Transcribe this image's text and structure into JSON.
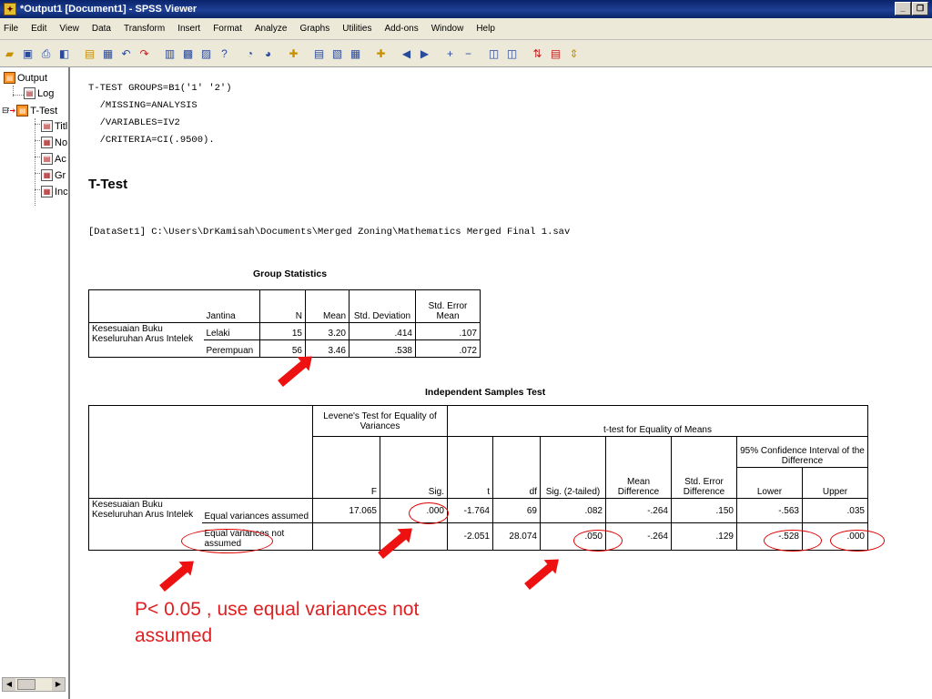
{
  "window": {
    "title": "*Output1 [Document1] - SPSS Viewer"
  },
  "menu": [
    "File",
    "Edit",
    "View",
    "Data",
    "Transform",
    "Insert",
    "Format",
    "Analyze",
    "Graphs",
    "Utilities",
    "Add-ons",
    "Window",
    "Help"
  ],
  "tree": {
    "output": "Output",
    "log": "Log",
    "ttest": "T-Test",
    "children": [
      "Titl",
      "No",
      "Ac",
      "Gr",
      "Inc"
    ]
  },
  "syntax": "T-TEST GROUPS=B1('1' '2')\n  /MISSING=ANALYSIS\n  /VARIABLES=IV2\n  /CRITERIA=CI(.9500).",
  "heading": "T-Test",
  "dataset": "[DataSet1] C:\\Users\\DrKamisah\\Documents\\Merged Zoning\\Mathematics Merged Final 1.sav",
  "group_stats": {
    "title": "Group Statistics",
    "headers": {
      "jantina": "Jantina",
      "n": "N",
      "mean": "Mean",
      "sd": "Std. Deviation",
      "se": "Std. Error Mean"
    },
    "variable": "Kesesuaian Buku Keseluruhan Arus Intelek",
    "rows": [
      {
        "group": "Lelaki",
        "n": "15",
        "mean": "3.20",
        "sd": ".414",
        "se": ".107"
      },
      {
        "group": "Perempuan",
        "n": "56",
        "mean": "3.46",
        "sd": ".538",
        "se": ".072"
      }
    ]
  },
  "ind_test": {
    "title": "Independent Samples Test",
    "levene": "Levene's Test for Equality of Variances",
    "ttest": "t-test for Equality of Means",
    "ci": "95% Confidence Interval of the Difference",
    "cols": {
      "f": "F",
      "sig": "Sig.",
      "t": "t",
      "df": "df",
      "sig2": "Sig. (2-tailed)",
      "md": "Mean Difference",
      "sed": "Std. Error Difference",
      "lower": "Lower",
      "upper": "Upper"
    },
    "variable": "Kesesuaian Buku Keseluruhan Arus Intelek",
    "rows": [
      {
        "label": "Equal variances assumed",
        "f": "17.065",
        "sig": ".000",
        "t": "-1.764",
        "df": "69",
        "sig2": ".082",
        "md": "-.264",
        "sed": ".150",
        "lower": "-.563",
        "upper": ".035"
      },
      {
        "label": "Equal variances not assumed",
        "f": "",
        "sig": "",
        "t": "-2.051",
        "df": "28.074",
        "sig2": ".050",
        "md": "-.264",
        "sed": ".129",
        "lower": "-.528",
        "upper": ".000"
      }
    ]
  },
  "annotation": "P< 0.05 , use equal variances not assumed",
  "colors": {
    "annotation": "#e02020",
    "titlebar": "#0a246a"
  }
}
